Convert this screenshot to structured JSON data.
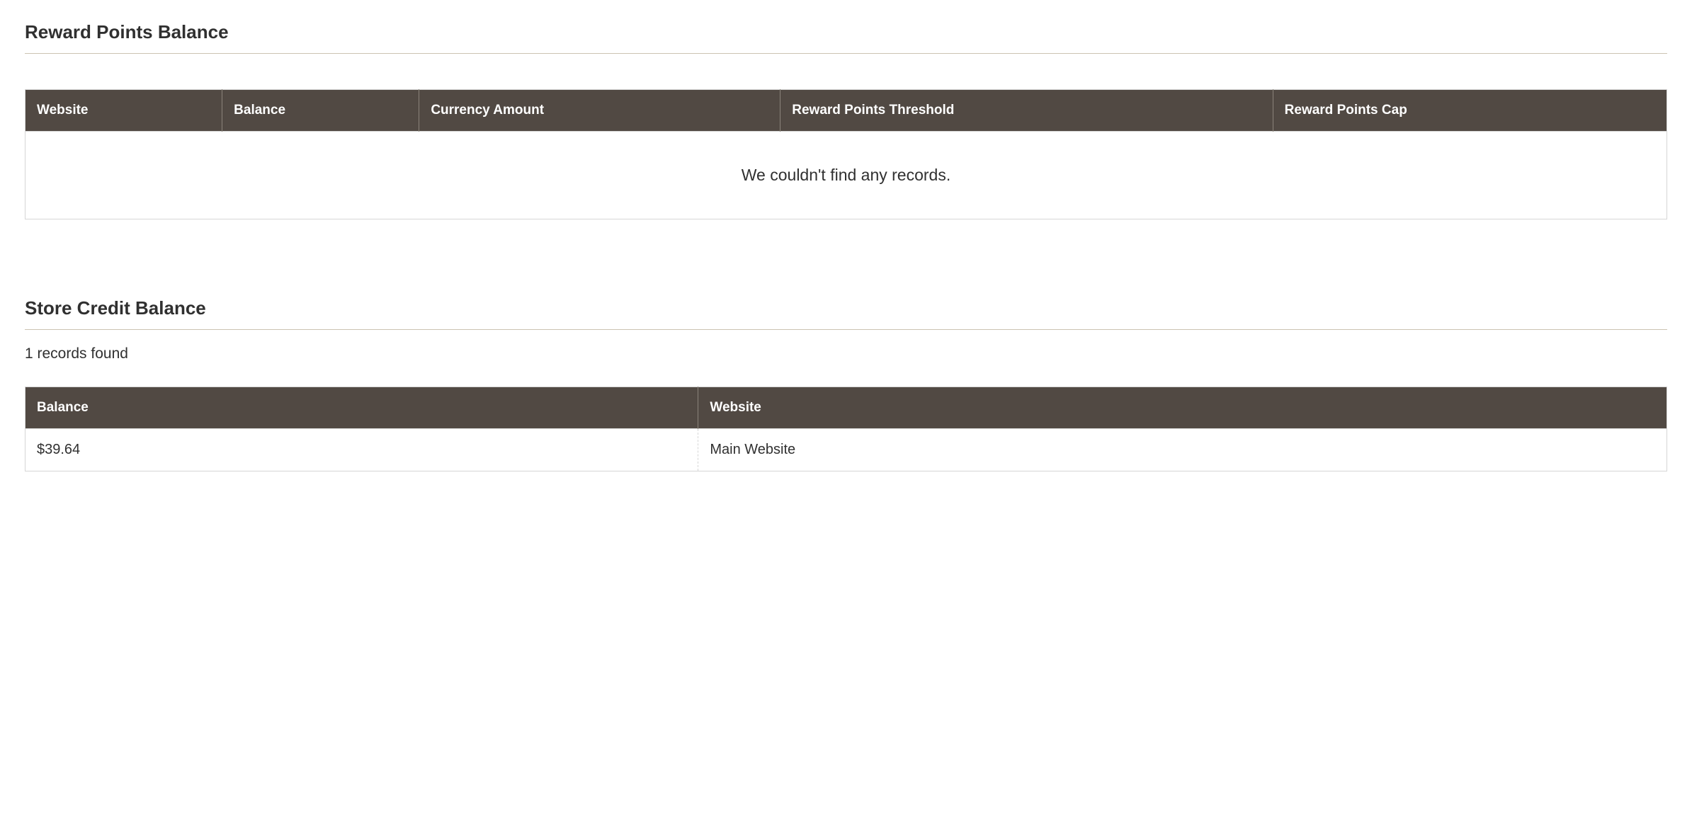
{
  "reward_points": {
    "title": "Reward Points Balance",
    "columns": {
      "website": "Website",
      "balance": "Balance",
      "currency_amount": "Currency Amount",
      "threshold": "Reward Points Threshold",
      "cap": "Reward Points Cap"
    },
    "empty_message": "We couldn't find any records."
  },
  "store_credit": {
    "title": "Store Credit Balance",
    "records_found": "1 records found",
    "columns": {
      "balance": "Balance",
      "website": "Website"
    },
    "rows": [
      {
        "balance": "$39.64",
        "website": "Main Website"
      }
    ]
  }
}
